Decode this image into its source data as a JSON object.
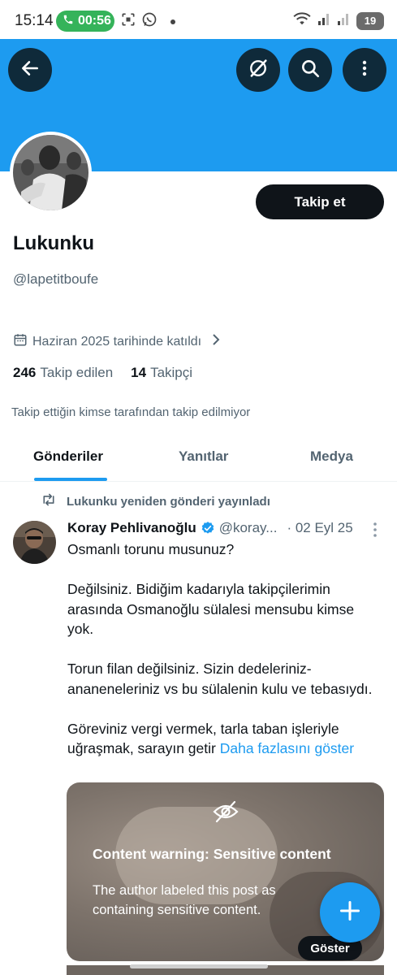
{
  "status_bar": {
    "time": "15:14",
    "call_timer": "00:56",
    "battery": "19"
  },
  "header": {
    "back_icon": "arrow-left-icon",
    "grok_icon": "grok-icon",
    "search_icon": "search-icon",
    "more_icon": "more-vertical-icon",
    "banner_color": "#1d9bf0"
  },
  "profile": {
    "follow_label": "Takip et",
    "display_name": "Lukunku",
    "handle": "@lapetitboufe",
    "joined": "Haziran 2025 tarihinde katıldı",
    "following_count": "246",
    "following_label": "Takip edilen",
    "followers_count": "14",
    "followers_label": "Takipçi",
    "not_followed_text": "Takip ettiğin kimse tarafından takip edilmiyor"
  },
  "tabs": [
    {
      "label": "Gönderiler",
      "active": true
    },
    {
      "label": "Yanıtlar",
      "active": false
    },
    {
      "label": "Medya",
      "active": false
    }
  ],
  "post": {
    "repost_text": "Lukunku yeniden gönderi yayınladı",
    "author_name": "Koray Pehlivanoğlu",
    "author_handle": "@koray...",
    "date": "· 02 Eyl 25",
    "paragraphs": [
      "Osmanlı torunu musunuz?",
      "Değilsiniz. Bidiğim kadarıyla takipçilerimin arasında Osmanoğlu sülalesi mensubu kimse yok.",
      "Torun filan değilsiniz. Sizin dedeleriniz-ananeneleriniz vs bu sülalenin kulu ve tebasıydı.",
      "Göreviniz vergi vermek, tarla taban işleriyle uğraşmak, sarayın getir"
    ],
    "show_more": "Daha fazlasını göster",
    "media": {
      "warning_title": "Content warning: Sensitive content",
      "warning_desc": "The author labeled this post as containing sensitive content.",
      "show_label": "Göster"
    }
  },
  "fab": {
    "icon": "plus-icon",
    "color": "#1d9bf0"
  }
}
